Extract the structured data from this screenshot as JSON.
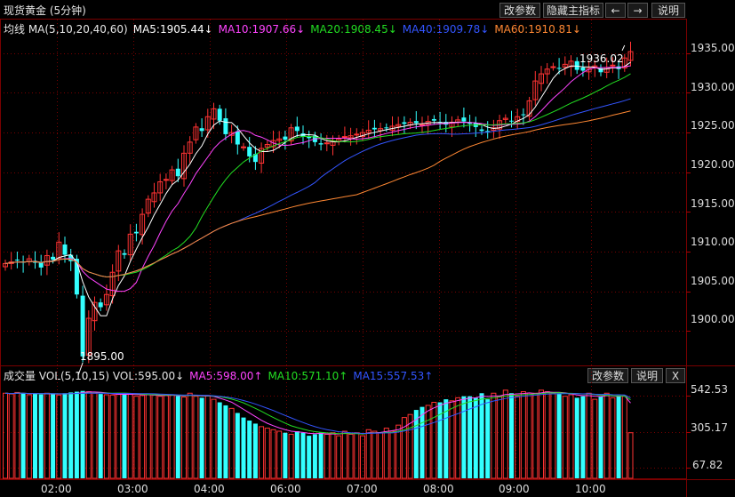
{
  "header": {
    "title": "现货黄金 (5分钟)",
    "buttons": [
      "改参数",
      "隐藏主指标",
      "←",
      "→",
      "说明"
    ]
  },
  "price_pane": {
    "ma_title": "均线 MA(5,10,20,40,60)",
    "ma": [
      {
        "label": "MA5:1905.44↓",
        "color": "#ffffff"
      },
      {
        "label": "MA10:1907.66↓",
        "color": "#ff44ff"
      },
      {
        "label": "MA20:1908.45↓",
        "color": "#22dd22"
      },
      {
        "label": "MA40:1909.78↓",
        "color": "#3355ff"
      },
      {
        "label": "MA60:1910.81↓",
        "color": "#ff8833"
      }
    ],
    "high_label": "1936.02",
    "low_label": "1895.00",
    "y_ticks": [
      "1935.00",
      "1930.00",
      "1925.00",
      "1920.00",
      "1915.00",
      "1910.00",
      "1905.00",
      "1900.00"
    ]
  },
  "volume_pane": {
    "title": "成交量 VOL(5,10,15) VOL:595.00↓",
    "ma": [
      {
        "label": "MA5:598.00↑",
        "color": "#ff44ff"
      },
      {
        "label": "MA10:571.10↑",
        "color": "#22dd22"
      },
      {
        "label": "MA15:557.53↑",
        "color": "#3355ff"
      }
    ],
    "buttons": [
      "改参数",
      "说明",
      "X"
    ],
    "y_ticks": [
      "542.53",
      "305.17",
      "67.82"
    ]
  },
  "time_axis": [
    "02:00",
    "03:00",
    "04:00",
    "06:00",
    "07:00",
    "08:00",
    "09:00",
    "10:00"
  ],
  "colors": {
    "up": "#ff3333",
    "down": "#33ffff",
    "grid": "#7a0000"
  },
  "chart_data": {
    "type": "candlestick",
    "interval": "5 min",
    "ylim": [
      1896,
      1937
    ],
    "approx_close": [
      1908.5,
      1908.7,
      1908.9,
      1908.6,
      1909.1,
      1908.6,
      1908.0,
      1909.5,
      1909.0,
      1911.2,
      1909.6,
      1908.8,
      1904.6,
      1896.8,
      1901.6,
      1903.6,
      1903.0,
      1904.6,
      1907.4,
      1910.1,
      1909.6,
      1912.2,
      1912.3,
      1914.7,
      1916.6,
      1917.4,
      1918.8,
      1919.1,
      1920.3,
      1919.5,
      1922.4,
      1923.8,
      1925.7,
      1925.2,
      1927.0,
      1928.0,
      1926.5,
      1924.8,
      1925.0,
      1923.5,
      1923.2,
      1922.0,
      1921.3,
      1923.0,
      1923.5,
      1924.0,
      1924.2,
      1924.1,
      1925.6,
      1925.2,
      1924.5,
      1924.3,
      1923.8,
      1923.5,
      1923.7,
      1923.9,
      1924.2,
      1924.5,
      1924.6,
      1924.8,
      1925.0,
      1925.3,
      1925.4,
      1925.5,
      1925.6,
      1925.8,
      1926.0,
      1926.1,
      1926.3,
      1926.2,
      1926.0,
      1926.4,
      1926.5,
      1926.2,
      1926.0,
      1926.3,
      1926.6,
      1926.4,
      1926.1,
      1925.7,
      1925.2,
      1925.0,
      1925.6,
      1926.5,
      1926.8,
      1926.4,
      1927.0,
      1927.2,
      1929.0,
      1931.5,
      1932.4,
      1933.0,
      1933.3,
      1933.1,
      1933.6,
      1934.0,
      1932.9,
      1932.8,
      1933.1,
      1933.4,
      1932.6,
      1933.2,
      1933.5,
      1933.0,
      1934.4,
      1935.2
    ],
    "volume_ylim": [
      0,
      620
    ],
    "approx_volume": [
      560,
      555,
      565,
      560,
      550,
      558,
      552,
      560,
      555,
      548,
      560,
      565,
      570,
      575,
      570,
      560,
      555,
      550,
      548,
      552,
      560,
      555,
      540,
      545,
      550,
      548,
      540,
      545,
      550,
      542,
      535,
      560,
      540,
      530,
      545,
      520,
      500,
      480,
      460,
      430,
      400,
      380,
      360,
      340,
      330,
      320,
      310,
      300,
      290,
      310,
      300,
      280,
      290,
      300,
      290,
      300,
      280,
      310,
      290,
      300,
      280,
      320,
      310,
      300,
      330,
      310,
      350,
      400,
      420,
      450,
      470,
      480,
      500,
      500,
      520,
      510,
      530,
      540,
      540,
      530,
      560,
      520,
      560,
      540,
      580,
      560,
      540,
      570,
      560,
      560,
      580,
      570,
      560,
      560,
      540,
      550,
      530,
      540,
      560,
      520,
      540,
      560,
      530,
      545,
      540,
      300
    ]
  }
}
